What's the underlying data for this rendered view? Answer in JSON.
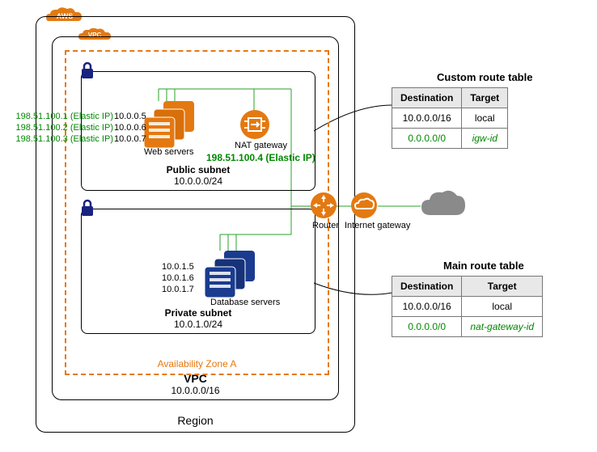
{
  "badges": {
    "aws": "AWS",
    "vpc": "VPC"
  },
  "region": {
    "label": "Region"
  },
  "vpc": {
    "label": "VPC",
    "cidr": "10.0.0.0/16"
  },
  "az": {
    "label": "Availability Zone A"
  },
  "public_subnet": {
    "title": "Public subnet",
    "cidr": "10.0.0.0/24"
  },
  "private_subnet": {
    "title": "Private  subnet",
    "cidr": "10.0.1.0/24"
  },
  "web": {
    "label": "Web servers",
    "eip1": "198.51.100.1 (Elastic IP)",
    "ip1": "10.0.0.5",
    "eip2": "198.51.100.2 (Elastic IP)",
    "ip2": "10.0.0.6",
    "eip3": "198.51.100.3 (Elastic IP)",
    "ip3": "10.0.0.7"
  },
  "db": {
    "label": "Database servers",
    "ip1": "10.0.1.5",
    "ip2": "10.0.1.6",
    "ip3": "10.0.1.7"
  },
  "nat": {
    "label": "NAT gateway",
    "eip": "198.51.100.4 (Elastic IP)"
  },
  "router": {
    "label": "Router"
  },
  "igw": {
    "label": "Internet gateway"
  },
  "custom_table": {
    "title": "Custom route table",
    "col_dest": "Destination",
    "col_target": "Target",
    "r1_dest": "10.0.0.0/16",
    "r1_target": "local",
    "r2_dest": "0.0.0.0/0",
    "r2_target": "igw-id"
  },
  "main_table": {
    "title": "Main route table",
    "col_dest": "Destination",
    "col_target": "Target",
    "r1_dest": "10.0.0.0/16",
    "r1_target": "local",
    "r2_dest": "0.0.0.0/0",
    "r2_target": "nat-gateway-id"
  }
}
